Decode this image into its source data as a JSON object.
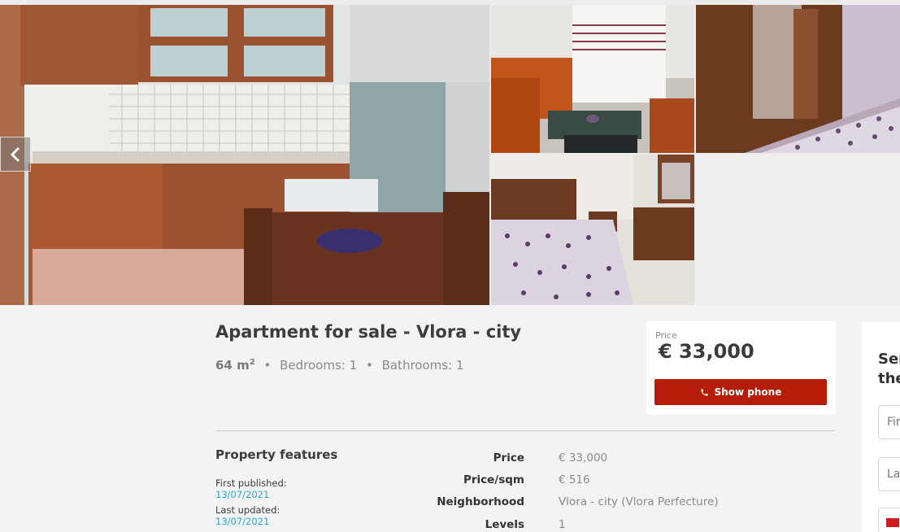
{
  "gallery": {
    "photos": [
      {
        "name": "photo-kitchen",
        "alt": "kitchen"
      },
      {
        "name": "photo-living-room",
        "alt": "living room"
      },
      {
        "name": "photo-bedroom-wardrobe",
        "alt": "bedroom wardrobe"
      },
      {
        "name": "photo-bedroom",
        "alt": "bedroom"
      }
    ],
    "prev_icon": "chevron-left-icon"
  },
  "listing": {
    "title": "Apartment for sale - Vlora - city",
    "area": "64 m",
    "area_sup": "2",
    "bedrooms": "Bedrooms: 1",
    "bathrooms": "Bathrooms: 1",
    "separator": "•"
  },
  "price_box": {
    "label": "Price",
    "value": "€ 33,000",
    "button_label": "Show phone",
    "button_icon": "phone-icon",
    "button_color": "#b51d0a"
  },
  "features": {
    "title": "Property features",
    "first_published_label": "First published:",
    "first_published_date": "13/07/2021",
    "last_updated_label": "Last updated:",
    "last_updated_date": "13/07/2021",
    "date_color": "#2aa7c9",
    "facts": [
      {
        "key": "Price",
        "value": "€ 33,000"
      },
      {
        "key": "Price/sqm",
        "value": "€ 516"
      },
      {
        "key": "Neighborhood",
        "value": "Vlora - city (Vlora Perfecture)"
      },
      {
        "key": "Levels",
        "value": "1"
      }
    ]
  },
  "contact": {
    "title_line1": "Sen",
    "title_line2": "the",
    "first_placeholder": "Fir",
    "last_placeholder": "La"
  }
}
